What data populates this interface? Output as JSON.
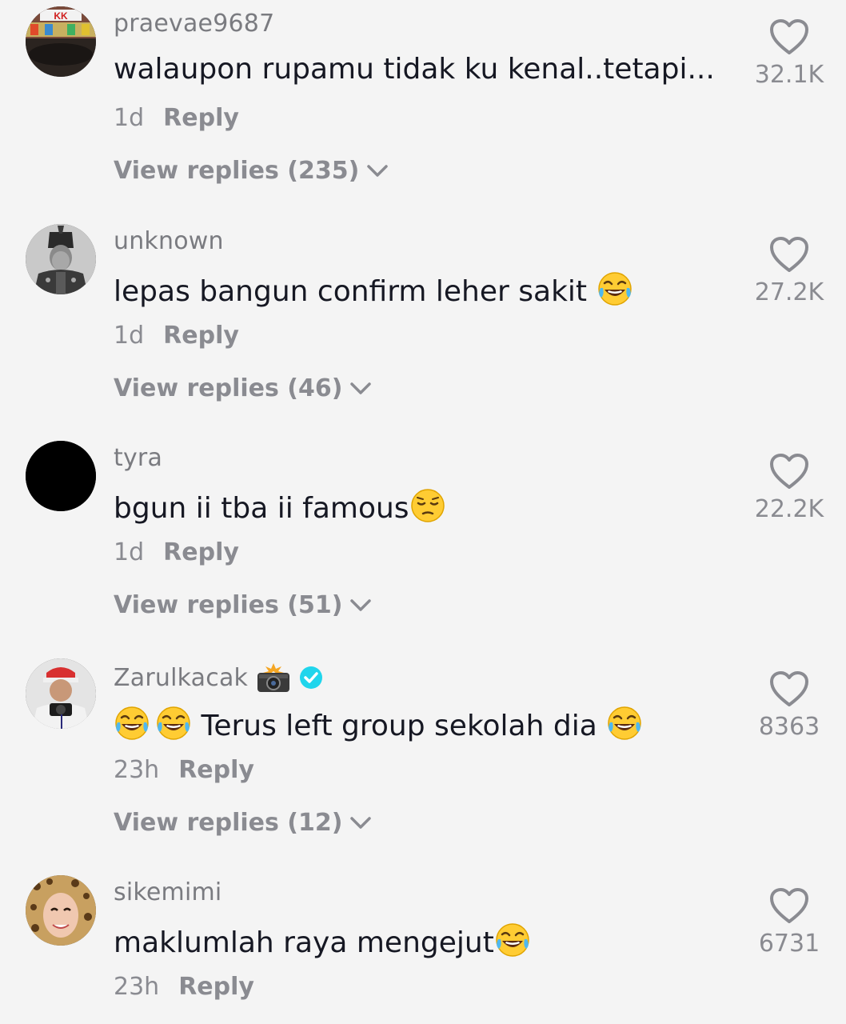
{
  "comments": [
    {
      "username": "praevae9687",
      "text": "walaupon rupamu tidak ku kenal..tetapi...",
      "time": "1d",
      "reply_label": "Reply",
      "view_replies": "View replies (235)",
      "likes": "32.1K"
    },
    {
      "username": "unknown",
      "text": "lepas bangun confirm leher sakit",
      "time": "1d",
      "reply_label": "Reply",
      "view_replies": "View replies (46)",
      "likes": "27.2K"
    },
    {
      "username": "tyra",
      "text": "bgun ii tba ii famous",
      "time": "1d",
      "reply_label": "Reply",
      "view_replies": "View replies (51)",
      "likes": "22.2K"
    },
    {
      "username": "Zarulkacak",
      "text": "Terus left group sekolah dia",
      "time": "23h",
      "reply_label": "Reply",
      "view_replies": "View replies (12)",
      "likes": "8363"
    },
    {
      "username": "sikemimi",
      "text": "maklumlah raya mengejut",
      "time": "23h",
      "reply_label": "Reply",
      "likes": "6731"
    }
  ],
  "icons": {
    "like": "heart-outline-icon",
    "expand": "chevron-down-icon",
    "verified": "verified-badge-icon"
  },
  "colors": {
    "background": "#f4f4f4",
    "primary_text": "#161823",
    "secondary_text": "#8a8b91",
    "verified": "#20d5ec"
  }
}
